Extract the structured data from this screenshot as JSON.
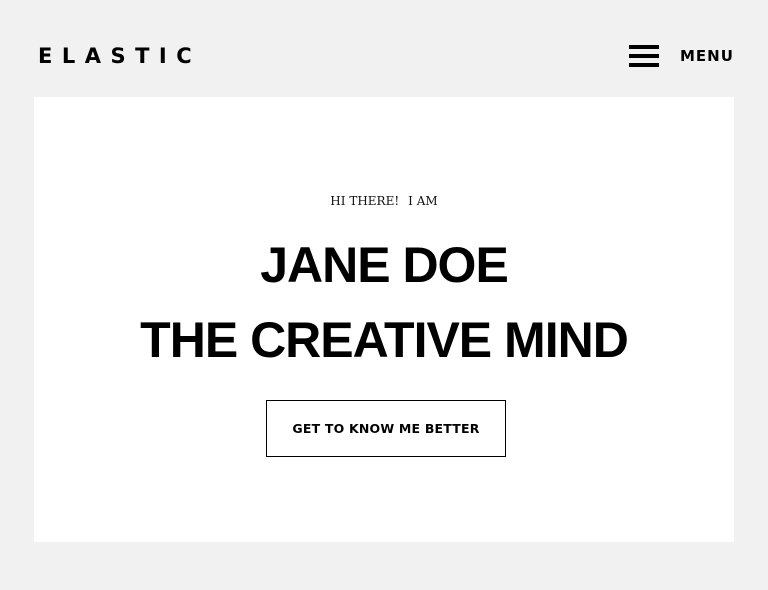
{
  "header": {
    "logo_text": "ELASTIC",
    "menu_label": "MENU",
    "menu_icon": "hamburger-icon"
  },
  "hero": {
    "greeting": "HI THERE!",
    "greeting_suffix": "I AM",
    "name": "JANE DOE",
    "tagline": "THE CREATIVE MIND",
    "cta_label": "GET TO KNOW ME BETTER"
  },
  "colors": {
    "page_background": "#f1f1f1",
    "card_background": "#ffffff",
    "text": "#000000"
  }
}
